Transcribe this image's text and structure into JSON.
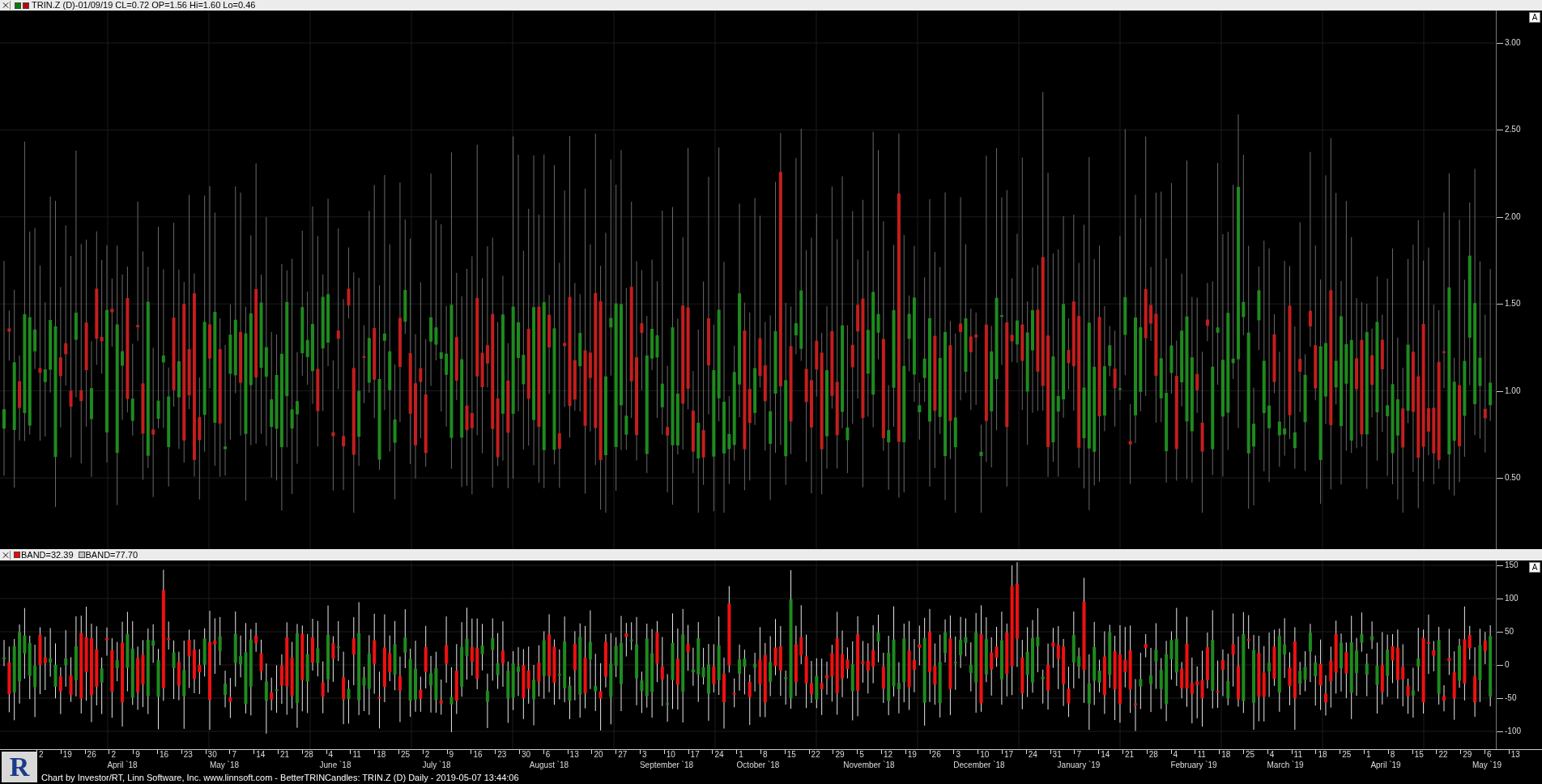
{
  "price_panel": {
    "legend_swatches": [
      {
        "color": "#008000"
      },
      {
        "color": "#c00000"
      }
    ],
    "title": "TRIN.Z (D)-01/09/19 CL=0.72 OP=1.56 Hi=1.60 Lo=0.46",
    "scale_button": "A",
    "y_ticks": [
      "3.00",
      "2.50",
      "2.00",
      "1.50",
      "1.00",
      "0.50"
    ]
  },
  "band_panel": {
    "legend": [
      {
        "color": "#ff0000",
        "label": "BAND=32.39"
      },
      {
        "color": "#c0c0c0",
        "label": "BAND=77.70"
      }
    ],
    "scale_button": "A",
    "y_ticks": [
      "150",
      "100",
      "50",
      "0",
      "-50",
      "-100"
    ]
  },
  "date_axis": {
    "days": [
      "2",
      "19",
      "26",
      "2",
      "9",
      "16",
      "23",
      "30",
      "7",
      "14",
      "21",
      "28",
      "4",
      "11",
      "18",
      "25",
      "2",
      "9",
      "16",
      "23",
      "30",
      "6",
      "13",
      "20",
      "27",
      "3",
      "10",
      "17",
      "24",
      "1",
      "8",
      "15",
      "22",
      "29",
      "5",
      "12",
      "19",
      "26",
      "3",
      "10",
      "17",
      "24",
      "31",
      "7",
      "14",
      "21",
      "28",
      "4",
      "11",
      "18",
      "25",
      "4",
      "11",
      "18",
      "25",
      "1",
      "8",
      "15",
      "22",
      "29",
      "6",
      "13"
    ],
    "months": [
      "April `18",
      "May `18",
      "June `18",
      "July `18",
      "August `18",
      "September `18",
      "October `18",
      "November `18",
      "December `18",
      "January `19",
      "February `19",
      "March `19",
      "April `19",
      "May `19"
    ]
  },
  "logo": {
    "letter": "R"
  },
  "footer": "Chart by Investor/RT, Linn Software, Inc. www.linnsoft.com - BetterTRINCandles: TRIN.Z (D) Daily - 2019-05-07 13:44:06"
}
